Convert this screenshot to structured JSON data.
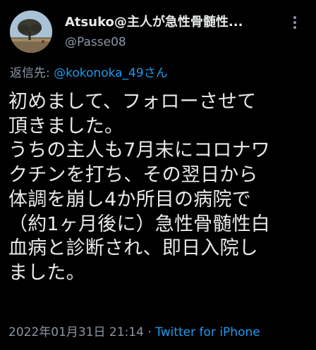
{
  "tweet": {
    "author": {
      "display_name": "Atsuko@主人が急性骨髄性...",
      "handle": "@Passe08",
      "avatar_icon": "tree-landscape-avatar"
    },
    "reply": {
      "prefix": "返信先: ",
      "mention": "@kokonoka_49さん"
    },
    "body_lines": [
      "初めまして、フォローさせて",
      "頂きました。",
      "うちの主人も7月末にコロナワ",
      "クチンを打ち、その翌日から",
      "体調を崩し4か所目の病院で",
      "（約1ヶ月後に）急性骨髄性白",
      "血病と診断され、即日入院し",
      "ました。"
    ],
    "footer": {
      "date": "2022年01月31日 21:14",
      "separator": " · ",
      "source": "Twitter for iPhone"
    },
    "more_icon": "more-horizontal-icon"
  },
  "colors": {
    "background": "#000000",
    "primary_text": "#e7e9ea",
    "secondary_text": "#8b98a5",
    "accent": "#1d9bf0"
  }
}
